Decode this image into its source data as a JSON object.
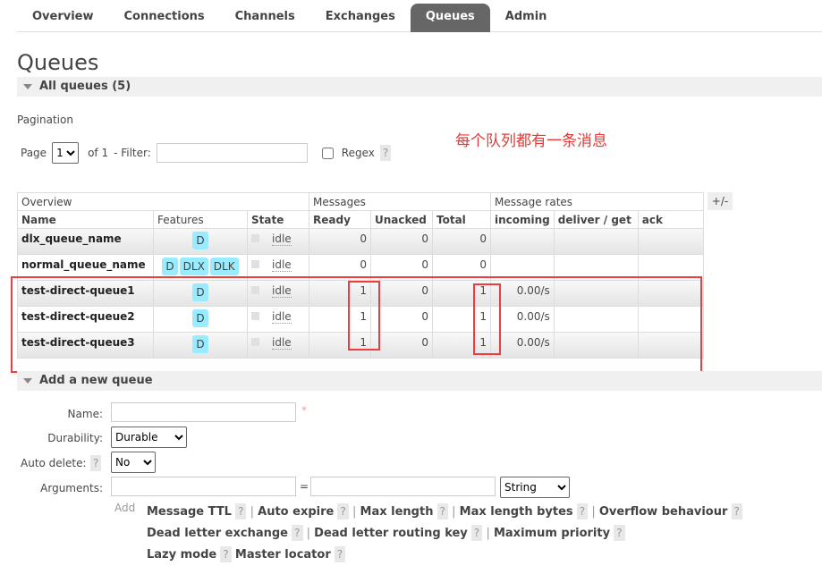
{
  "nav": {
    "tabs": [
      "Overview",
      "Connections",
      "Channels",
      "Exchanges",
      "Queues",
      "Admin"
    ],
    "active": "Queues"
  },
  "page_title": "Queues",
  "all_queues": "All queues (5)",
  "pagination": {
    "label": "Pagination",
    "page_label": "Page",
    "page_value": "1",
    "of": "of 1",
    "filter_label": "- Filter:",
    "filter_value": "",
    "regex_label": "Regex",
    "help": "?"
  },
  "annotation": "每个队列都有一条消息",
  "table": {
    "group_headers": [
      "Overview",
      "Messages",
      "Message rates"
    ],
    "toggle": "+/-",
    "columns": [
      "Name",
      "Features",
      "State",
      "Ready",
      "Unacked",
      "Total",
      "incoming",
      "deliver / get",
      "ack"
    ],
    "rows": [
      {
        "name": "dlx_queue_name",
        "features": [
          "D"
        ],
        "state": "idle",
        "ready": "0",
        "unacked": "0",
        "total": "0",
        "incoming": "",
        "deliver": "",
        "ack": ""
      },
      {
        "name": "normal_queue_name",
        "features": [
          "D",
          "DLX",
          "DLK"
        ],
        "state": "idle",
        "ready": "0",
        "unacked": "0",
        "total": "0",
        "incoming": "",
        "deliver": "",
        "ack": ""
      },
      {
        "name": "test-direct-queue1",
        "features": [
          "D"
        ],
        "state": "idle",
        "ready": "1",
        "unacked": "0",
        "total": "1",
        "incoming": "0.00/s",
        "deliver": "",
        "ack": ""
      },
      {
        "name": "test-direct-queue2",
        "features": [
          "D"
        ],
        "state": "idle",
        "ready": "1",
        "unacked": "0",
        "total": "1",
        "incoming": "0.00/s",
        "deliver": "",
        "ack": ""
      },
      {
        "name": "test-direct-queue3",
        "features": [
          "D"
        ],
        "state": "idle",
        "ready": "1",
        "unacked": "0",
        "total": "1",
        "incoming": "0.00/s",
        "deliver": "",
        "ack": ""
      }
    ]
  },
  "add_queue": {
    "title": "Add a new queue",
    "name_label": "Name:",
    "name_value": "",
    "required": "*",
    "durability_label": "Durability:",
    "durability_value": "Durable",
    "auto_delete_label": "Auto delete:",
    "auto_delete_value": "No",
    "arguments_label": "Arguments:",
    "equals": "=",
    "type_value": "String",
    "add_label": "Add",
    "arg_links": [
      "Message TTL",
      "Auto expire",
      "Max length",
      "Max length bytes",
      "Overflow behaviour",
      "Dead letter exchange",
      "Dead letter routing key",
      "Maximum priority",
      "Lazy mode",
      "Master locator"
    ]
  },
  "colors": {
    "active_tab": "#666666",
    "badge": "#99ebff",
    "highlight": "#f03c3c",
    "annotation": "#e53935"
  }
}
